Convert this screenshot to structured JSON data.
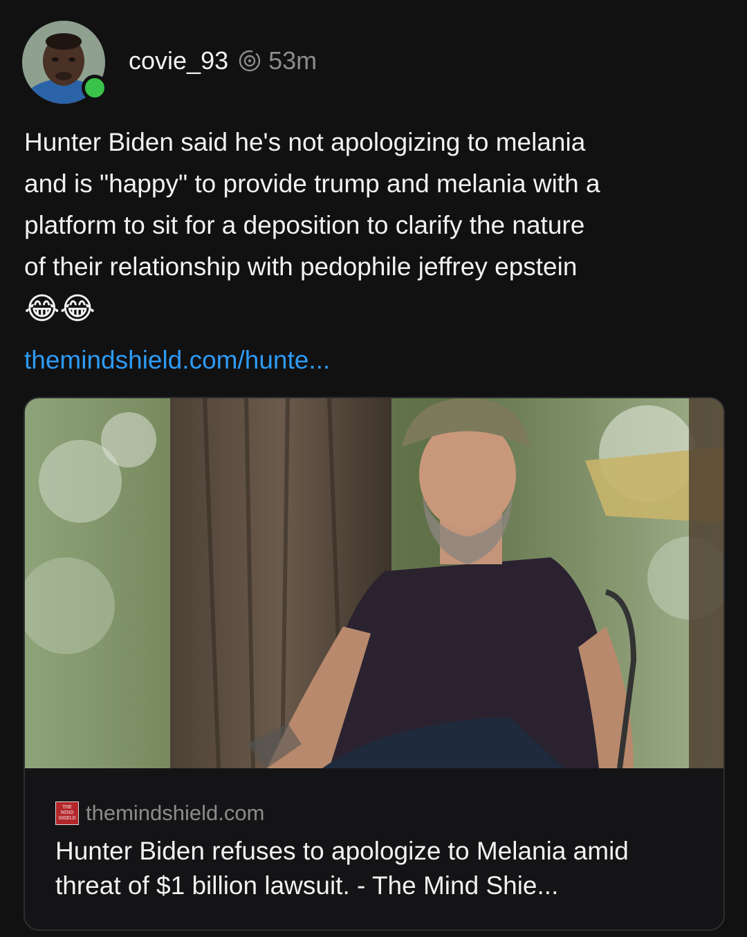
{
  "post": {
    "username": "covie_93",
    "time": "53m",
    "icons": {
      "threads": "threads-icon",
      "online": "online-status-dot"
    },
    "text": "Hunter Biden said he's not apologizing to melania\nand is \"happy\" to provide trump and melania with a\nplatform to sit for a deposition to clarify the nature\nof their relationship with pedophile jeffrey epstein",
    "emoji": "😂😂",
    "link_text": "themindshield.com/hunte..."
  },
  "link_card": {
    "source_domain": "themindshield.com",
    "source_logo_lines": [
      "THE",
      "MIND",
      "SHIELD"
    ],
    "title": "Hunter Biden refuses to apologize to Melania amid threat of $1 billion lawsuit. - The Mind Shie..."
  },
  "colors": {
    "background": "#111112",
    "text": "#f2f2f2",
    "muted": "#8c8c8c",
    "link": "#2e9bf5",
    "online": "#3ac34a",
    "card_border": "#2e2e30"
  }
}
